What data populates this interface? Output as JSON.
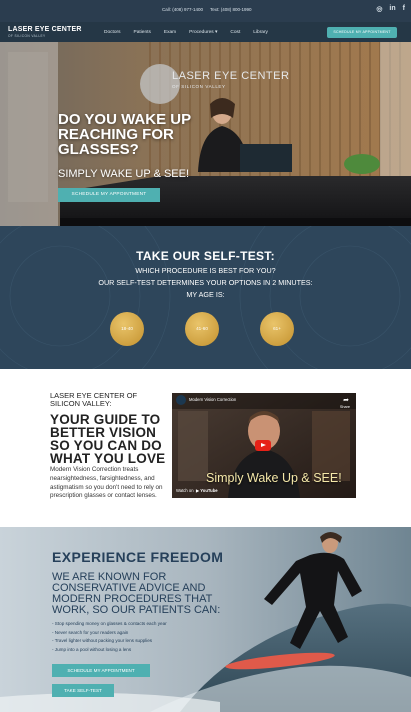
{
  "topbar": {
    "call": "Call: (408) 977-1400",
    "text": "Text: (408) 800-1990",
    "social": {
      "instagram": "◎",
      "linkedin": "in",
      "facebook": "f"
    }
  },
  "nav": {
    "logo_title": "LASER EYE CENTER",
    "logo_sub": "OF SILICON VALLEY",
    "menu": [
      "Doctors",
      "Patients",
      "Exam",
      "Procedures ▾",
      "Cost",
      "Library"
    ],
    "cta": "SCHEDULE MY APPOINTMENT"
  },
  "hero": {
    "sign_title": "LASER EYE CENTER",
    "sign_sub": "OF SILICON VALLEY",
    "headline": "DO YOU WAKE UP REACHING FOR GLASSES?",
    "subhead": "SIMPLY WAKE UP & SEE!",
    "button": "SCHEDULE MY APPOINTMENT"
  },
  "selftest": {
    "title": "TAKE OUR SELF-TEST:",
    "line1": "WHICH PROCEDURE IS BEST FOR YOU?",
    "line2": "OUR SELF-TEST DETERMINES YOUR OPTIONS IN 2 MINUTES:",
    "line3": "MY AGE IS:",
    "ages": [
      "18-40",
      "41-60",
      "61+"
    ]
  },
  "guide": {
    "label": "LASER EYE CENTER OF SILICON VALLEY:",
    "title": "YOUR GUIDE TO BETTER VISION SO YOU CAN DO WHAT YOU LOVE",
    "body": "Modern Vision Correction treats nearsightedness, farsightedness, and astigmatism so you don't need to rely on prescription glasses or contact lenses.",
    "video": {
      "title": "Modern Vision Correction",
      "share": "Share",
      "caption": "Simply Wake Up & SEE!",
      "watch": "Watch on",
      "youtube": "▶ YouTube"
    }
  },
  "freedom": {
    "title": "EXPERIENCE FREEDOM",
    "subtitle": "WE ARE KNOWN FOR CONSERVATIVE ADVICE AND MODERN PROCEDURES THAT WORK, SO OUR PATIENTS CAN:",
    "list": [
      "- Stop spending money on glasses & contacts each year",
      "- Never search for your readers again",
      "- Travel lighter without packing your lens supplies",
      "- Jump into a pool without losing a lens"
    ],
    "button1": "SCHEDULE MY APPOINTMENT",
    "button2": "TAKE SELF-TEST"
  },
  "colors": {
    "teal": "#4fb0b1",
    "navy": "#2e465b",
    "gold": "#d4a94c"
  }
}
